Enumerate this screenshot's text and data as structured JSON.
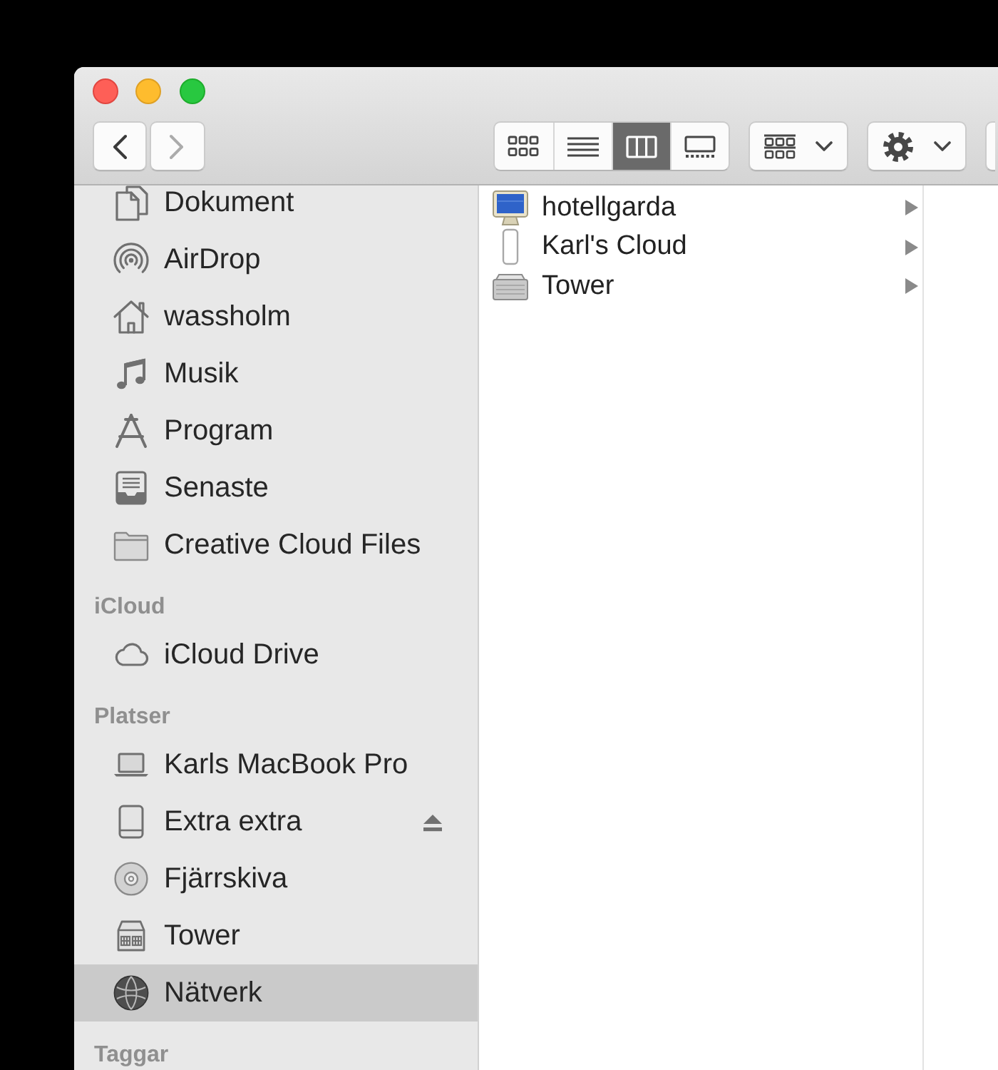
{
  "window": {
    "controls": [
      {
        "kind": "close"
      },
      {
        "kind": "minimize"
      },
      {
        "kind": "zoom"
      }
    ]
  },
  "toolbar": {
    "navigation": [
      {
        "kind": "back",
        "disabled": false
      },
      {
        "kind": "forward",
        "disabled": true
      }
    ],
    "view_modes": [
      {
        "kind": "icons",
        "selected": false
      },
      {
        "kind": "list",
        "selected": false
      },
      {
        "kind": "columns",
        "selected": true
      },
      {
        "kind": "gallery",
        "selected": false
      }
    ],
    "buttons": [
      {
        "kind": "arrange"
      },
      {
        "kind": "action"
      },
      {
        "kind": "blank"
      }
    ]
  },
  "sidebar": {
    "sections": [
      {
        "items": [
          {
            "label": "Dokument",
            "kind": "document",
            "selected": false
          },
          {
            "label": "AirDrop",
            "kind": "airdrop",
            "selected": false
          },
          {
            "label": "wassholm",
            "kind": "home",
            "selected": false
          },
          {
            "label": "Musik",
            "kind": "music",
            "selected": false
          },
          {
            "label": "Program",
            "kind": "applications",
            "selected": false
          },
          {
            "label": "Senaste",
            "kind": "recent",
            "selected": false
          },
          {
            "label": "Creative Cloud Files",
            "kind": "folder",
            "selected": false
          }
        ]
      },
      {
        "heading": "iCloud",
        "items": [
          {
            "label": "iCloud Drive",
            "kind": "cloud",
            "selected": false
          }
        ]
      },
      {
        "heading": "Platser",
        "items": [
          {
            "label": "Karls MacBook Pro",
            "kind": "laptop",
            "selected": false,
            "ejectable": false
          },
          {
            "label": "Extra extra",
            "kind": "drive",
            "selected": false,
            "ejectable": true
          },
          {
            "label": "Fjärrskiva",
            "kind": "disc",
            "selected": false,
            "ejectable": false
          },
          {
            "label": "Tower",
            "kind": "server",
            "selected": false,
            "ejectable": false
          },
          {
            "label": "Nätverk",
            "kind": "network",
            "selected": true,
            "ejectable": false
          }
        ]
      },
      {
        "heading": "Taggar"
      }
    ]
  },
  "browser": {
    "columns": [
      {
        "items": [
          {
            "label": "hotellgarda",
            "kind": "display",
            "selected": false,
            "has_children": true
          },
          {
            "label": "Karl's Cloud",
            "kind": "device",
            "selected": false,
            "has_children": true
          },
          {
            "label": "Tower",
            "kind": "server",
            "selected": false,
            "has_children": true
          }
        ]
      }
    ]
  }
}
